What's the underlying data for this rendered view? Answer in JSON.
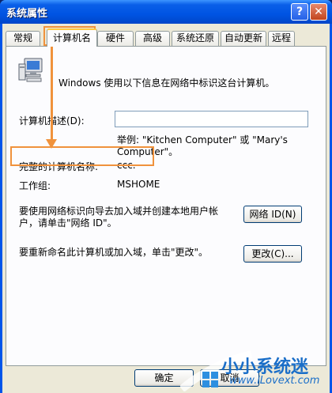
{
  "window": {
    "title": "系统属性",
    "help_label": "?",
    "close_label": "✕"
  },
  "tabs": [
    {
      "label": "常规"
    },
    {
      "label": "计算机名"
    },
    {
      "label": "硬件"
    },
    {
      "label": "高级"
    },
    {
      "label": "系统还原"
    },
    {
      "label": "自动更新"
    },
    {
      "label": "远程"
    }
  ],
  "panel": {
    "intro": "Windows 使用以下信息在网络中标识这台计算机。",
    "description_label": "计算机描述(D):",
    "description_value": "",
    "example_line1": "举例: \"Kitchen Computer\" 或 \"Mary's",
    "example_line2": "Computer\"。",
    "full_name_label": "完整的计算机名称:",
    "full_name_value": "ccc.",
    "workgroup_label": "工作组:",
    "workgroup_value": "MSHOME",
    "network_id_text_line1": "要使用网络标识向导去加入域并创建本地用户帐",
    "network_id_text_line2": "户，请单击\"网络 ID\"。",
    "network_id_button": "网络 ID(N)",
    "rename_text": "要重新命名此计算机或加入域，单击\"更改\"。",
    "change_button": "更改(C)..."
  },
  "footer": {
    "ok_button": "确定",
    "cancel_button": "取消"
  },
  "watermark": {
    "text": "小小系统迷",
    "url": "www.iLovext.com"
  },
  "colors": {
    "highlight": "#f0923c",
    "titlebar": "#0054e3"
  }
}
